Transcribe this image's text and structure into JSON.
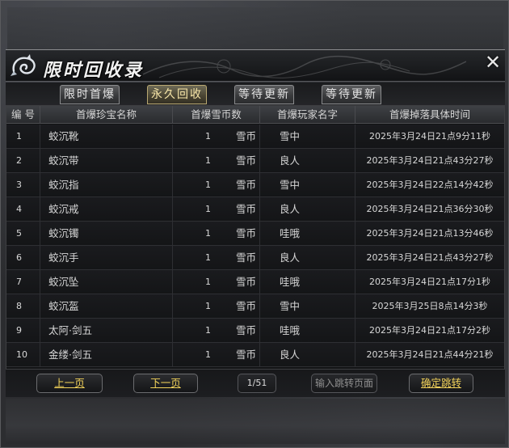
{
  "window": {
    "title": "限时回收录",
    "close_glyph": "✕"
  },
  "tabs": [
    {
      "label": "限时首爆",
      "active": false
    },
    {
      "label": "永久回收",
      "active": true
    },
    {
      "label": "等待更新",
      "active": false
    },
    {
      "label": "等待更新",
      "active": false
    }
  ],
  "table": {
    "headers": {
      "index": "编  号",
      "name": "首爆珍宝名称",
      "currency": "首爆雪币数",
      "player": "首爆玩家名字",
      "time": "首爆掉落具体时间"
    },
    "rows": [
      {
        "index": "1",
        "name": "蛟沉靴",
        "amount": "1",
        "unit": "雪币",
        "player": "雪中",
        "time": "2025年3月24日21点9分11秒"
      },
      {
        "index": "2",
        "name": "蛟沉带",
        "amount": "1",
        "unit": "雪币",
        "player": "良人",
        "time": "2025年3月24日21点43分27秒"
      },
      {
        "index": "3",
        "name": "蛟沉指",
        "amount": "1",
        "unit": "雪币",
        "player": "雪中",
        "time": "2025年3月24日22点14分42秒"
      },
      {
        "index": "4",
        "name": "蛟沉戒",
        "amount": "1",
        "unit": "雪币",
        "player": "良人",
        "time": "2025年3月24日21点36分30秒"
      },
      {
        "index": "5",
        "name": "蛟沉镯",
        "amount": "1",
        "unit": "雪币",
        "player": "哇哦",
        "time": "2025年3月24日21点13分46秒"
      },
      {
        "index": "6",
        "name": "蛟沉手",
        "amount": "1",
        "unit": "雪币",
        "player": "良人",
        "time": "2025年3月24日21点43分27秒"
      },
      {
        "index": "7",
        "name": "蛟沉坠",
        "amount": "1",
        "unit": "雪币",
        "player": "哇哦",
        "time": "2025年3月24日21点17分1秒"
      },
      {
        "index": "8",
        "name": "蛟沉盔",
        "amount": "1",
        "unit": "雪币",
        "player": "雪中",
        "time": "2025年3月25日8点14分3秒"
      },
      {
        "index": "9",
        "name": "太阿·剑五",
        "amount": "1",
        "unit": "雪币",
        "player": "哇哦",
        "time": "2025年3月24日21点17分2秒"
      },
      {
        "index": "10",
        "name": "金缕·剑五",
        "amount": "1",
        "unit": "雪币",
        "player": "良人",
        "time": "2025年3月24日21点44分21秒"
      }
    ]
  },
  "pager": {
    "prev_label": "上一页",
    "next_label": "下一页",
    "page_indicator": "1/51",
    "jump_placeholder": "输入跳转页面",
    "confirm_label": "确定跳转"
  }
}
